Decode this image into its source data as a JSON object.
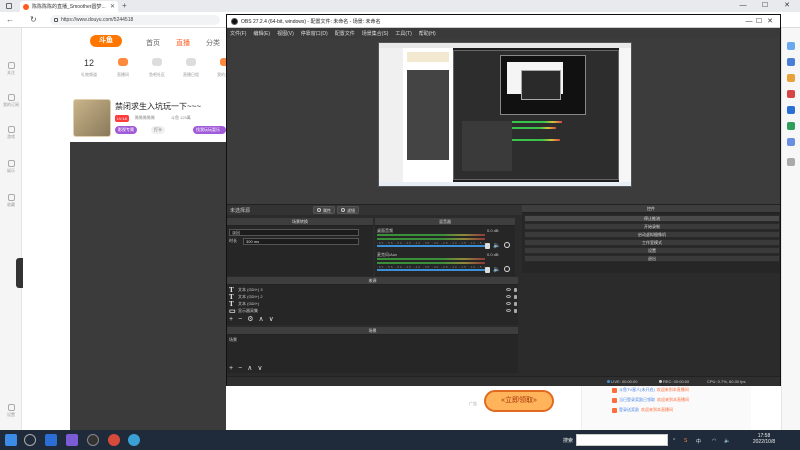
{
  "browser": {
    "tab_title": "陈陈陈陈的直播_Smoother圆梦...",
    "url": "https://www.douyu.com/5244518",
    "win_min": "—",
    "win_max": "☐",
    "win_close": "✕",
    "new_tab": "+",
    "tab_close": "✕",
    "back": "←",
    "refresh": "↻"
  },
  "douyu": {
    "logo": "斗鱼",
    "nav": [
      "首页",
      "直播",
      "分类"
    ],
    "rail": [
      "关注",
      "我的订阅",
      "游戏",
      "娱乐",
      "收藏",
      "设置"
    ],
    "stats": [
      {
        "value": "12",
        "label": "礼物频道"
      },
      {
        "value": "",
        "label": "直播间"
      },
      {
        "value": "",
        "label": "鱼吧社区"
      },
      {
        "value": "",
        "label": "直播日程"
      },
      {
        "value": "",
        "label": "我的关注"
      }
    ],
    "room_title": "禁闭求生入坑玩一下~~~",
    "level_badge": "LV.18",
    "streamer_name": "陈陈陈陈陈",
    "streamer_meta": "斗鱼  123萬",
    "tags": [
      "影视专属",
      "打卡",
      "找我玩玩耍乐趣"
    ],
    "promo": "«立即领取»",
    "gift_label": "广告",
    "chat": [
      {
        "name": "斗鱼TV星人(未开启)",
        "action": "欢迎来到本直播间"
      },
      {
        "name": "当日登录奖励已领取",
        "action": "欢迎来到本直播间"
      },
      {
        "name": "登录送奖励",
        "action": "欢迎来到本直播间"
      }
    ]
  },
  "obs": {
    "title": "OBS 27.2.4 (64-bit, windows) - 配置文件: 未命名 - 场景: 未命名",
    "menu": [
      "文件(F)",
      "编辑(E)",
      "视图(V)",
      "停靠窗口(D)",
      "配置文件",
      "场景集合(S)",
      "工具(T)",
      "帮助(H)"
    ],
    "no_source": "未选择源",
    "props_btn": "属性",
    "filters_btn": "滤镜",
    "docks": {
      "transition": "场景转换",
      "mixer": "混音器",
      "controls": "控件",
      "sources": "来源",
      "scenes": "场景"
    },
    "transition": {
      "type_value": "淡出",
      "duration_label": "时长",
      "duration_value": "300 ms"
    },
    "mixer": [
      {
        "name": "桌面音频",
        "db": "0.0 dB",
        "ticks": "-60 -55 -50 -45 -40 -35 -30 -25 -20 -15 -10 -5 0"
      },
      {
        "name": "麦克风/Aux",
        "db": "0.0 dB",
        "ticks": "-60 -55 -50 -45 -40 -35 -30 -25 -20 -15 -10 -5 0"
      }
    ],
    "controls": [
      "停止推流",
      "开始录制",
      "启动虚拟摄像机",
      "工作室模式",
      "设置",
      "退出"
    ],
    "sources": [
      {
        "name": "文本 (GDI+) 3"
      },
      {
        "name": "文本 (GDI+) 2"
      },
      {
        "name": "文本 (GDI+)"
      },
      {
        "name": "显示器采集"
      }
    ],
    "scenes": [
      "场景"
    ],
    "toolbar": {
      "add": "+",
      "remove": "−",
      "up": "∧",
      "down": "∨"
    },
    "status": {
      "live": "LIVE: 00:00:00",
      "rec": "REC: 00:00:00",
      "cpu": "CPU: 0.7%, 60.00 fps"
    }
  },
  "taskbar": {
    "search_label": "搜索",
    "time": "17:58",
    "date": "2022/10/8",
    "lang": "中",
    "tray_s": "S"
  },
  "colors": {
    "douyu_orange": "#ff5d23",
    "obs_bg": "#2b2b2b",
    "taskbar": "#1f2b3a"
  }
}
